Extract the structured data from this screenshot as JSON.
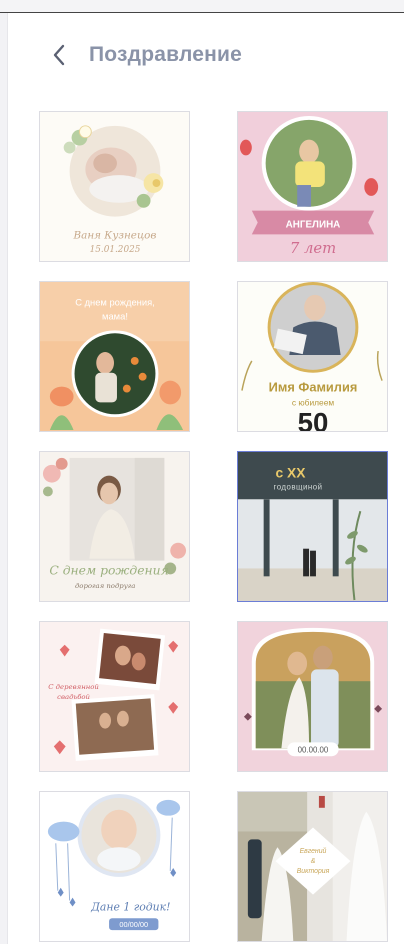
{
  "header": {
    "back_icon": "chevron-left-icon",
    "title": "Поздравление"
  },
  "templates": [
    {
      "name": "Ваня Кузнецов",
      "date": "15.01.2025"
    },
    {
      "name": "АНГЕЛИНА",
      "age": "7 лет"
    },
    {
      "line1": "С днем рождения,",
      "line2": "мама!"
    },
    {
      "name": "Имя Фамилия",
      "subtitle": "с юбилеем",
      "number": "50"
    },
    {
      "title": "С днем рождения",
      "subtitle": "дорогая подруга"
    },
    {
      "title": "с XX",
      "subtitle": "годовщиной"
    },
    {
      "line1": "С деревянной",
      "line2": "свадьбой"
    },
    {
      "date": "00.00.00"
    },
    {
      "title": "Дане 1 годик!",
      "date": "00/00/00"
    },
    {
      "line1": "Евгений",
      "line2": "&",
      "line3": "Виктория"
    }
  ],
  "colors": {
    "title": "#8a93a8",
    "card_border": "#dcdce2",
    "selected_border": "#6b7dd6"
  }
}
